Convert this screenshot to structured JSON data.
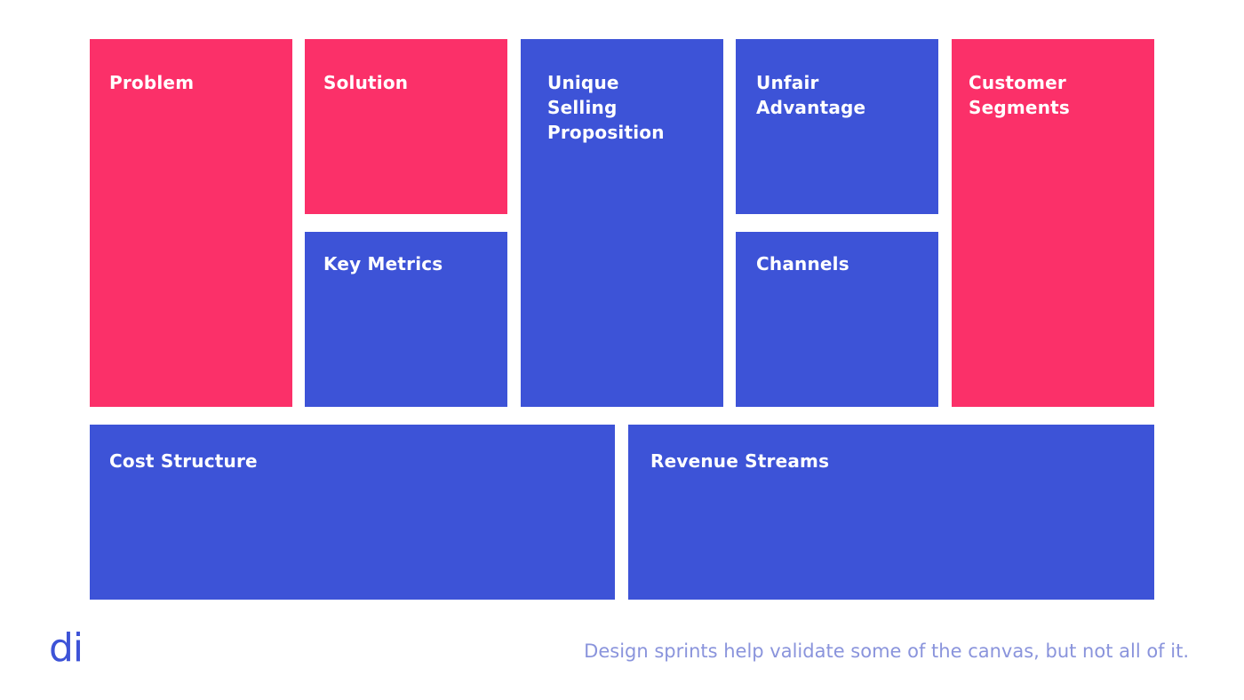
{
  "canvas": {
    "colors": {
      "pink": "#fb3069",
      "blue": "#3d53d7",
      "caption": "#8a94dc"
    },
    "blocks": {
      "problem": {
        "label": "Problem",
        "color": "pink"
      },
      "solution": {
        "label": "Solution",
        "color": "pink"
      },
      "key_metrics": {
        "label": "Key Metrics",
        "color": "blue"
      },
      "usp": {
        "label": "Unique\nSelling\nProposition",
        "color": "blue"
      },
      "unfair_advantage": {
        "label": "Unfair\nAdvantage",
        "color": "blue"
      },
      "channels": {
        "label": "Channels",
        "color": "blue"
      },
      "customer_segments": {
        "label": "Customer\nSegments",
        "color": "pink"
      },
      "cost_structure": {
        "label": "Cost Structure",
        "color": "blue"
      },
      "revenue_streams": {
        "label": "Revenue Streams",
        "color": "blue"
      }
    }
  },
  "footer": {
    "logo_text": "di",
    "caption": "Design sprints help validate some of the canvas, but not all of it."
  }
}
